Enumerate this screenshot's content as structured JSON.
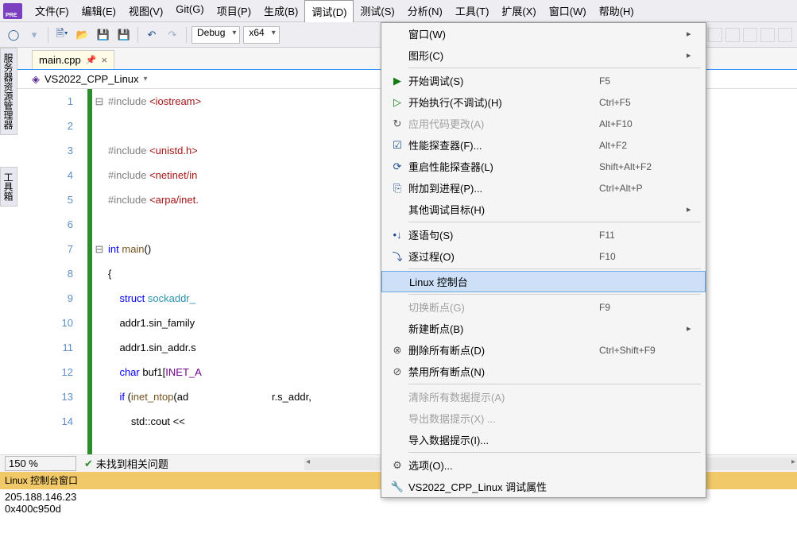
{
  "menubar": [
    "文件(F)",
    "编辑(E)",
    "视图(V)",
    "Git(G)",
    "项目(P)",
    "生成(B)",
    "调试(D)",
    "测试(S)",
    "分析(N)",
    "工具(T)",
    "扩展(X)",
    "窗口(W)",
    "帮助(H)"
  ],
  "active_menu_index": 6,
  "toolbar": {
    "config": "Debug",
    "platform": "x64"
  },
  "sidetabs": [
    "服务器资源管理器",
    "工具箱"
  ],
  "editor_tab": {
    "filename": "main.cpp"
  },
  "breadcrumb": "VS2022_CPP_Linux",
  "line_numbers": [
    "1",
    "2",
    "3",
    "4",
    "5",
    "6",
    "7",
    "8",
    "9",
    "10",
    "11",
    "12",
    "13",
    "14"
  ],
  "fold_marks": [
    "⊟",
    "",
    "",
    "",
    "",
    "",
    "⊟",
    "",
    "",
    "",
    "",
    "",
    "",
    ""
  ],
  "code_lines": [
    "<span class=pp>#include</span> <span class=str>&lt;iostream&gt;</span>",
    "",
    "<span class=pp>#include</span> <span class=str>&lt;unistd.h&gt;</span>",
    "<span class=pp>#include</span> <span class=str>&lt;netinet/in</span>",
    "<span class=pp>#include</span> <span class=str>&lt;arpa/inet.</span>",
    "",
    "<span class=kw>int</span> <span class=fn>main</span>()",
    "{",
    "    <span class=kw>struct</span> <span class=tp>sockaddr_</span>",
    "    addr1.sin_family",
    "    addr1.sin_addr.s",
    "    <span class=kw>char</span> buf1[<span class=mac>INET_A</span>",
    "    <span class=kw>if</span> (<span class=fn>inet_ntop</span>(ad                             r.s_addr,",
    "        std::cout &lt;&lt;"
  ],
  "zoom": "150 %",
  "status": "未找到相关问题",
  "console": {
    "title": "Linux 控制台窗口",
    "line1": "205.188.146.23",
    "line2": "0x400c950d"
  },
  "dropdown": [
    {
      "icon": "",
      "label": "窗口(W)",
      "sc": "",
      "sub": "▸"
    },
    {
      "icon": "",
      "label": "图形(C)",
      "sc": "",
      "sub": "▸"
    },
    {
      "sep": true
    },
    {
      "icon": "▶",
      "cls": "gr",
      "label": "开始调试(S)",
      "sc": "F5"
    },
    {
      "icon": "▷",
      "cls": "gr",
      "label": "开始执行(不调试)(H)",
      "sc": "Ctrl+F5"
    },
    {
      "icon": "↻",
      "label": "应用代码更改(A)",
      "sc": "Alt+F10",
      "disabled": true
    },
    {
      "icon": "☑",
      "cls": "bl",
      "label": "性能探查器(F)...",
      "sc": "Alt+F2"
    },
    {
      "icon": "⟳",
      "cls": "bl",
      "label": "重启性能探查器(L)",
      "sc": "Shift+Alt+F2"
    },
    {
      "icon": "⎘",
      "cls": "bl",
      "label": "附加到进程(P)...",
      "sc": "Ctrl+Alt+P"
    },
    {
      "icon": "",
      "label": "其他调试目标(H)",
      "sc": "",
      "sub": "▸"
    },
    {
      "sep": true
    },
    {
      "icon": "•↓",
      "cls": "bl",
      "label": "逐语句(S)",
      "sc": "F11"
    },
    {
      "icon": "⤵",
      "cls": "bl",
      "label": "逐过程(O)",
      "sc": "F10"
    },
    {
      "sep": true
    },
    {
      "icon": "",
      "label": "Linux 控制台",
      "sc": "",
      "hl": true
    },
    {
      "sep": true
    },
    {
      "icon": "",
      "label": "切换断点(G)",
      "sc": "F9",
      "disabled": true
    },
    {
      "icon": "",
      "label": "新建断点(B)",
      "sc": "",
      "sub": "▸"
    },
    {
      "icon": "⊗",
      "label": "删除所有断点(D)",
      "sc": "Ctrl+Shift+F9"
    },
    {
      "icon": "⊘",
      "label": "禁用所有断点(N)",
      "sc": ""
    },
    {
      "sep": true
    },
    {
      "icon": "",
      "label": "清除所有数据提示(A)",
      "sc": "",
      "disabled": true
    },
    {
      "icon": "",
      "label": "导出数据提示(X) ...",
      "sc": "",
      "disabled": true
    },
    {
      "icon": "",
      "label": "导入数据提示(I)...",
      "sc": ""
    },
    {
      "sep": true
    },
    {
      "icon": "⚙",
      "label": "选项(O)...",
      "sc": ""
    },
    {
      "icon": "🔧",
      "label": "VS2022_CPP_Linux 调试属性",
      "sc": ""
    }
  ]
}
